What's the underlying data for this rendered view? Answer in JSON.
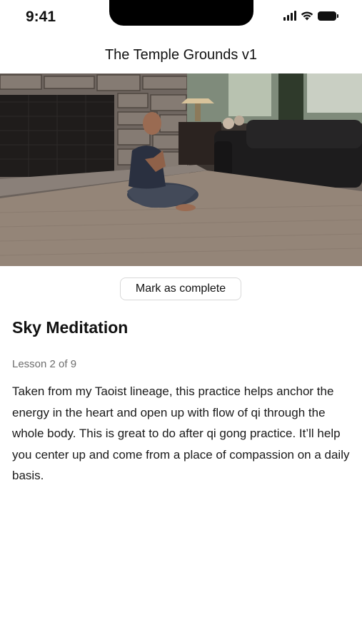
{
  "status_bar": {
    "time": "9:41",
    "icons": [
      "cellular-signal-icon",
      "wifi-icon",
      "battery-icon"
    ]
  },
  "nav": {
    "title": "The Temple Grounds v1"
  },
  "video": {
    "description_icon": "video-frame"
  },
  "actions": {
    "mark_complete_label": "Mark as complete"
  },
  "lesson": {
    "title": "Sky Meditation",
    "progress": "Lesson 2 of 9",
    "description": "Taken from my Taoist lineage, this practice helps anchor the energy in the heart and open up with flow of qi through the whole body. This is great to do after qi gong practice. It’ll help you center up and come from a place of compassion on a daily basis."
  }
}
